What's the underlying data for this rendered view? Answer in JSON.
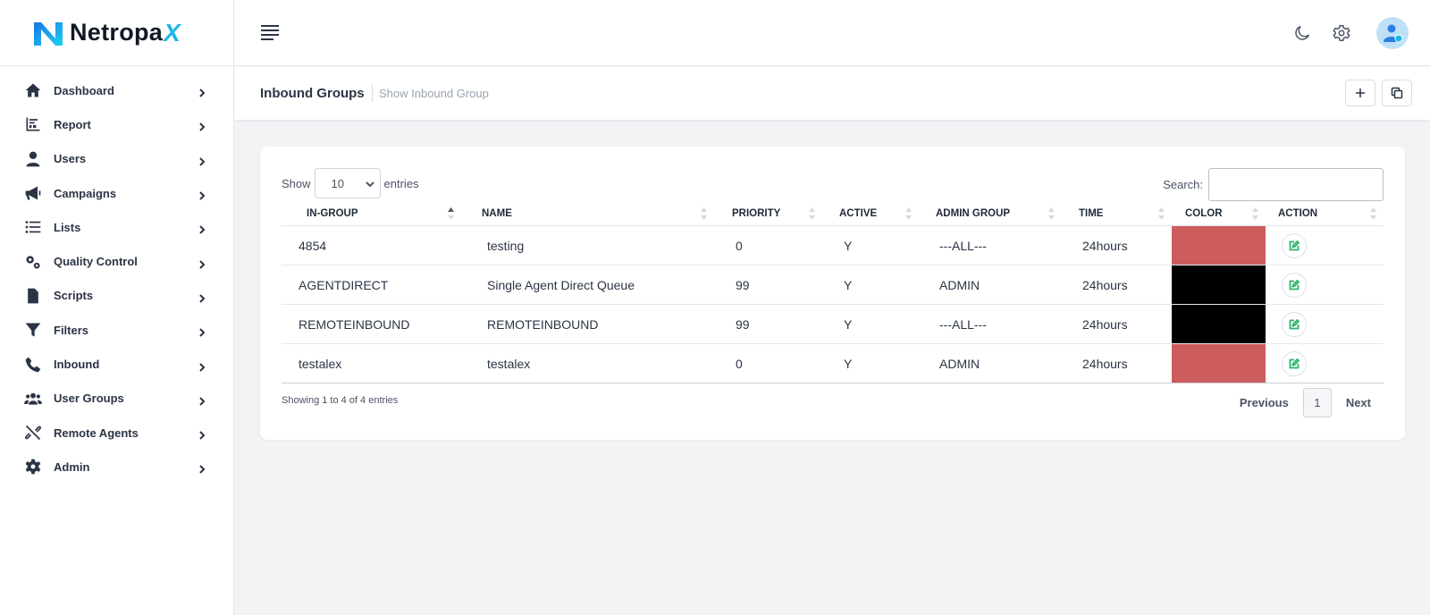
{
  "brand": {
    "name": "Netropa",
    "suffix": "X"
  },
  "sidebar": {
    "items": [
      {
        "label": "Dashboard",
        "icon": "home-icon"
      },
      {
        "label": "Report",
        "icon": "chart-icon"
      },
      {
        "label": "Users",
        "icon": "user-icon"
      },
      {
        "label": "Campaigns",
        "icon": "megaphone-icon"
      },
      {
        "label": "Lists",
        "icon": "list-icon"
      },
      {
        "label": "Quality Control",
        "icon": "gears-icon"
      },
      {
        "label": "Scripts",
        "icon": "file-icon"
      },
      {
        "label": "Filters",
        "icon": "filter-icon"
      },
      {
        "label": "Inbound",
        "icon": "phone-icon"
      },
      {
        "label": "User Groups",
        "icon": "users-icon"
      },
      {
        "label": "Remote Agents",
        "icon": "unlink-icon"
      },
      {
        "label": "Admin",
        "icon": "gear-icon"
      }
    ]
  },
  "header": {
    "title": "Inbound Groups",
    "subtitle": "Show Inbound Group"
  },
  "table_controls": {
    "show_label": "Show",
    "entries_value": "10",
    "entries_label": "entries",
    "search_label": "Search:",
    "search_value": ""
  },
  "table": {
    "columns": [
      "IN-GROUP",
      "NAME",
      "PRIORITY",
      "ACTIVE",
      "ADMIN GROUP",
      "TIME",
      "COLOR",
      "ACTION"
    ],
    "rows": [
      {
        "in_group": "4854",
        "name": "testing",
        "priority": "0",
        "active": "Y",
        "admin_group": "---ALL---",
        "time": "24hours",
        "color": "#cd5c5c"
      },
      {
        "in_group": "AGENTDIRECT",
        "name": "Single Agent Direct Queue",
        "priority": "99",
        "active": "Y",
        "admin_group": "ADMIN",
        "time": "24hours",
        "color": "#000000"
      },
      {
        "in_group": "REMOTEINBOUND",
        "name": "REMOTEINBOUND",
        "priority": "99",
        "active": "Y",
        "admin_group": "---ALL---",
        "time": "24hours",
        "color": "#000000"
      },
      {
        "in_group": "testalex",
        "name": "testalex",
        "priority": "0",
        "active": "Y",
        "admin_group": "ADMIN",
        "time": "24hours",
        "color": "#cd5c5c"
      }
    ],
    "info": "Showing 1 to 4 of 4 entries"
  },
  "pagination": {
    "previous": "Previous",
    "current": "1",
    "next": "Next"
  },
  "colors": {
    "accent": "#1fb6e6",
    "swatch_red": "#cd5c5c",
    "swatch_black": "#000000"
  }
}
